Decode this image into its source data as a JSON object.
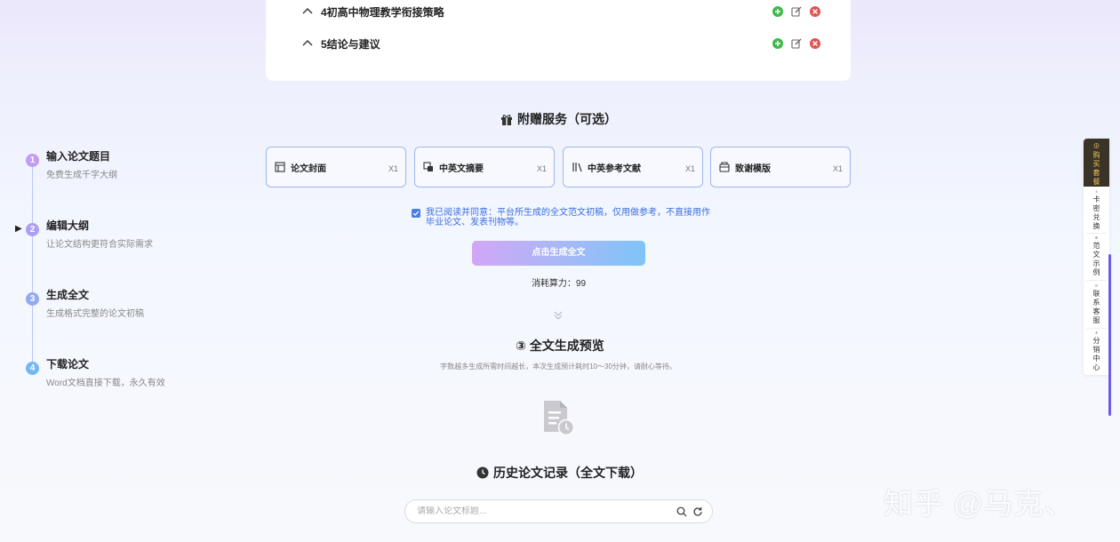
{
  "outline": {
    "items": [
      {
        "title": "4初高中物理教学衔接策略"
      },
      {
        "title": "5结论与建议"
      }
    ]
  },
  "steps": [
    {
      "num": "1",
      "title": "输入论文题目",
      "desc": "免费生成千字大纲",
      "color": "#c49cf4"
    },
    {
      "num": "2",
      "title": "编辑大纲",
      "desc": "让论文结构更符合实际需求",
      "color": "#ad9ff2"
    },
    {
      "num": "3",
      "title": "生成全文",
      "desc": "生成格式完整的论文初稿",
      "color": "#93a9f1"
    },
    {
      "num": "4",
      "title": "下载论文",
      "desc": "Word文档直接下载，永久有效",
      "color": "#74b8f3"
    }
  ],
  "current_step_marker": "▶",
  "extras": {
    "title": "附赠服务（可选）",
    "services": [
      {
        "label": "论文封面",
        "qty": "X1",
        "icon": "cover-icon"
      },
      {
        "label": "中英文摘要",
        "qty": "X1",
        "icon": "abstract-icon"
      },
      {
        "label": "中英参考文献",
        "qty": "X1",
        "icon": "books-icon"
      },
      {
        "label": "致谢模版",
        "qty": "X1",
        "icon": "thanks-icon"
      }
    ],
    "agreement": "我已阅读并同意：平台所生成的全文范文初稿，仅用做参考，不直接用作毕业论文、发表刊物等。",
    "agreement_checked": true,
    "generate_button": "点击生成全文",
    "cost": "消耗算力：99"
  },
  "preview": {
    "title": "③ 全文生成预览",
    "desc": "字数越多生成所需时间越长，本次生成预计耗时10～30分钟，请耐心等待。"
  },
  "history": {
    "title": "历史论文记录（全文下载）",
    "search_placeholder": "请输入论文标题..."
  },
  "sidebar": {
    "items": [
      {
        "label": "购买套餐",
        "icon": "coin-icon"
      },
      {
        "label": "卡密兑换",
        "icon": "key-icon"
      },
      {
        "label": "范文示例",
        "icon": "document-icon"
      },
      {
        "label": "联系客服",
        "icon": "chat-icon"
      },
      {
        "label": "分销中心",
        "icon": "money-bag-icon"
      }
    ]
  },
  "watermark": "知乎 @马克、",
  "colors": {
    "accent_blue": "#4a7ee0",
    "add_green": "#3fb94a",
    "delete_red": "#e05454",
    "sidebar_primary_bg": "#3a3327",
    "sidebar_primary_text": "#f0c45a"
  }
}
